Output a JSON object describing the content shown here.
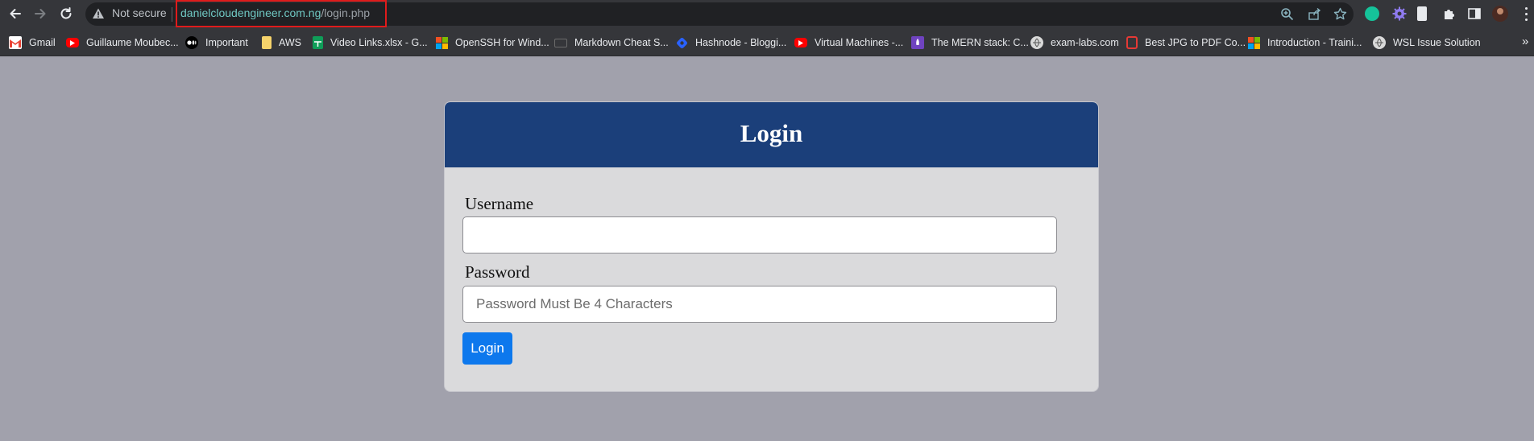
{
  "browser": {
    "security_label": "Not secure",
    "url_host": "danielcloudengineer.com.ng",
    "url_path": "/login.php",
    "accent_color": "#e01b1b"
  },
  "bookmarks": [
    {
      "label": "Gmail",
      "icon": "gmail-icon"
    },
    {
      "label": "Guillaume Moubec...",
      "icon": "youtube-icon"
    },
    {
      "label": "Important",
      "icon": "medium-icon"
    },
    {
      "label": "AWS",
      "icon": "folder-icon"
    },
    {
      "label": "Video Links.xlsx - G...",
      "icon": "sheets-icon"
    },
    {
      "label": "OpenSSH for Wind...",
      "icon": "microsoft-icon"
    },
    {
      "label": "Markdown Cheat S...",
      "icon": "markdown-icon"
    },
    {
      "label": "Hashnode - Bloggi...",
      "icon": "hashnode-icon"
    },
    {
      "label": "Virtual Machines -...",
      "icon": "youtube-icon"
    },
    {
      "label": "The MERN stack: C...",
      "icon": "rocket-icon"
    },
    {
      "label": "exam-labs.com",
      "icon": "globe-icon"
    },
    {
      "label": "Best JPG to PDF Co...",
      "icon": "pdf-icon"
    },
    {
      "label": "Introduction - Traini...",
      "icon": "microsoft-icon"
    },
    {
      "label": "WSL Issue Solution",
      "icon": "globe-icon"
    }
  ],
  "login": {
    "title": "Login",
    "username_label": "Username",
    "username_value": "",
    "password_label": "Password",
    "password_placeholder": "Password Must Be 4 Characters",
    "button_label": "Login",
    "header_color": "#1b3f7a",
    "button_color": "#0d78ed"
  }
}
